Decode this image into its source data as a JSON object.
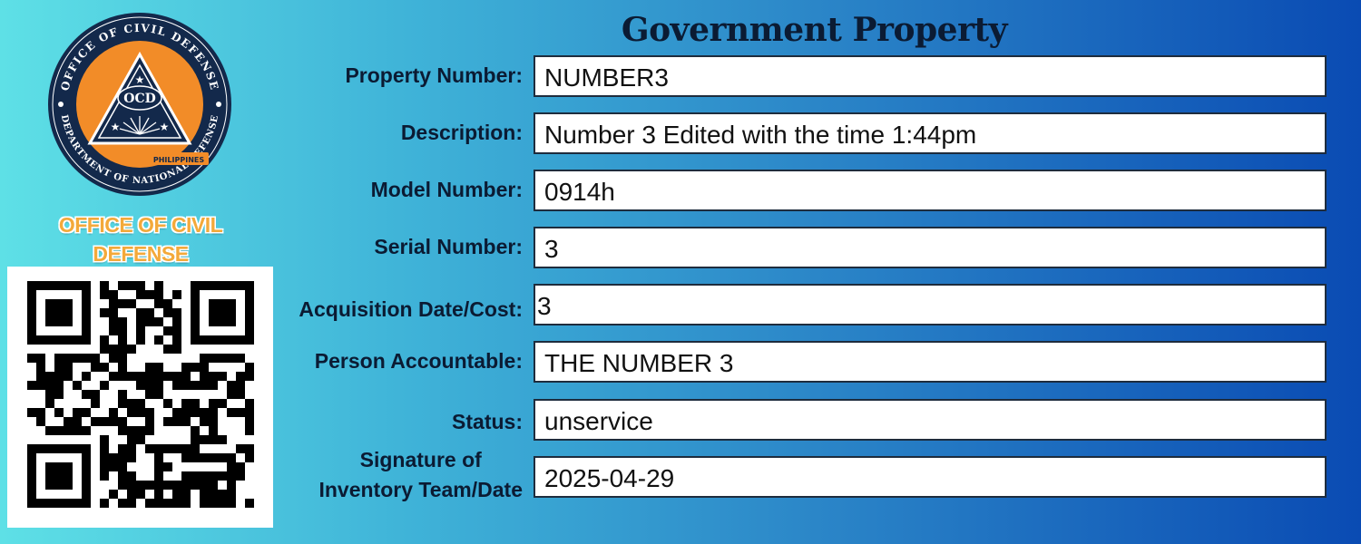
{
  "header": {
    "title": "Government Property"
  },
  "seal": {
    "ring_text": "OFFICE OF CIVIL DEFENSE",
    "lower_ring_text": "DEPARTMENT OF NATIONAL DEFENSE",
    "center_text": "OCD",
    "country": "PHILIPPINES",
    "colors": {
      "navy": "#13294b",
      "orange": "#f28c28"
    }
  },
  "org": {
    "line1": "OFFICE OF CIVIL",
    "line2": "DEFENSE"
  },
  "qr": {
    "icon": "qr-code"
  },
  "fields": [
    {
      "label": "Property Number:",
      "value": "NUMBER3"
    },
    {
      "label": "Description:",
      "value": "Number 3 Edited with the time 1:44pm"
    },
    {
      "label": "Model Number:",
      "value": "0914h"
    },
    {
      "label": "Serial Number:",
      "value": "3"
    },
    {
      "label": "Acquisition Date/Cost:",
      "value": "3"
    },
    {
      "label": "Person Accountable:",
      "value": "THE NUMBER 3"
    },
    {
      "label": "Status:",
      "value": "unservice"
    },
    {
      "label_line1": "Signature of",
      "label_line2": "Inventory Team/Date",
      "value": "2025-04-29"
    }
  ]
}
